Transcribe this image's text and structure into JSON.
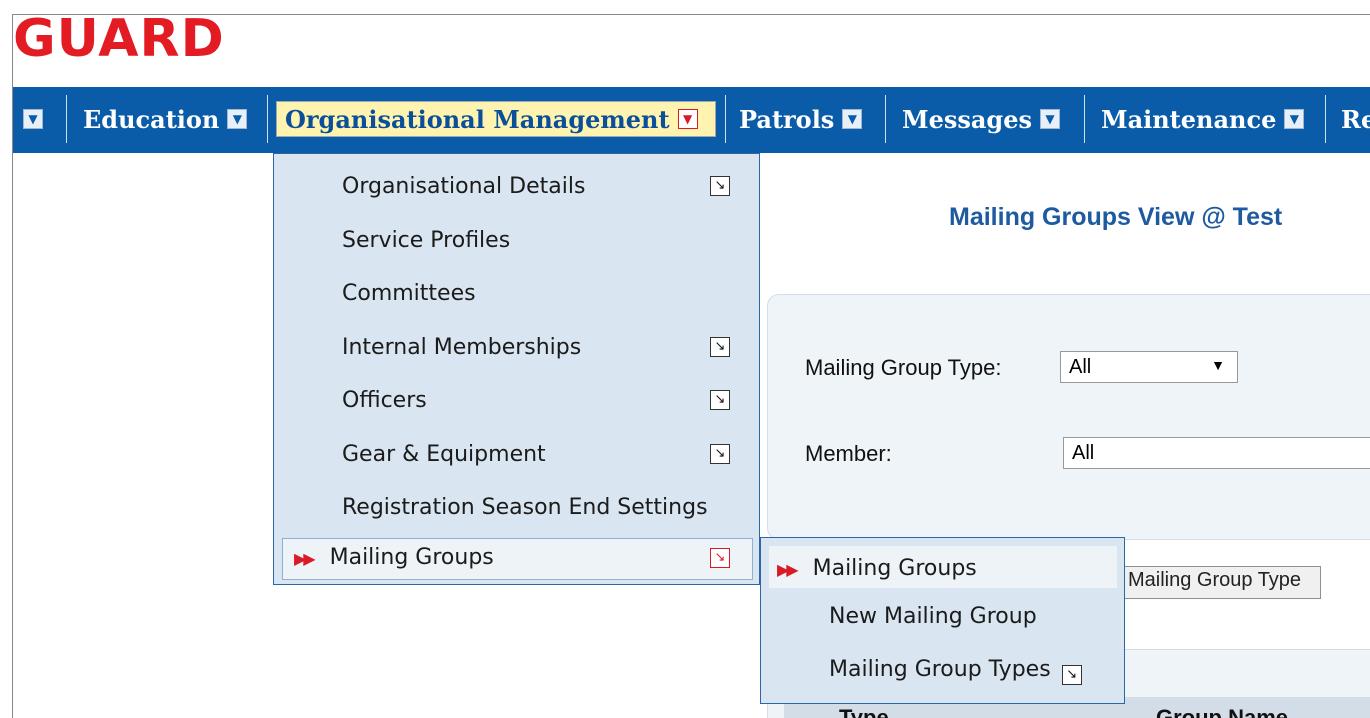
{
  "logo": {
    "text": "GUARD"
  },
  "navbar": {
    "items": [
      {
        "label": "Education"
      },
      {
        "label": "Organisational Management"
      },
      {
        "label": "Patrols"
      },
      {
        "label": "Messages"
      },
      {
        "label": "Maintenance"
      },
      {
        "label": "Re"
      }
    ]
  },
  "org_menu": {
    "items": [
      {
        "label": "Organisational Details"
      },
      {
        "label": "Service Profiles"
      },
      {
        "label": "Committees"
      },
      {
        "label": "Internal Memberships"
      },
      {
        "label": "Officers"
      },
      {
        "label": "Gear & Equipment"
      },
      {
        "label": "Registration Season End Settings"
      },
      {
        "label": "Mailing Groups"
      }
    ]
  },
  "mailing_submenu": {
    "items": [
      {
        "label": "Mailing Groups"
      },
      {
        "label": "New Mailing Group"
      },
      {
        "label": "Mailing Group Types"
      }
    ]
  },
  "page": {
    "title": "Mailing Groups View @ Test",
    "filter": {
      "type_label": "Mailing Group Type:",
      "type_value": "All",
      "member_label": "Member:",
      "member_value": "All"
    },
    "button_label": "Mailing Group Type",
    "table": {
      "headers": [
        "Type",
        "Group Name"
      ]
    }
  }
}
